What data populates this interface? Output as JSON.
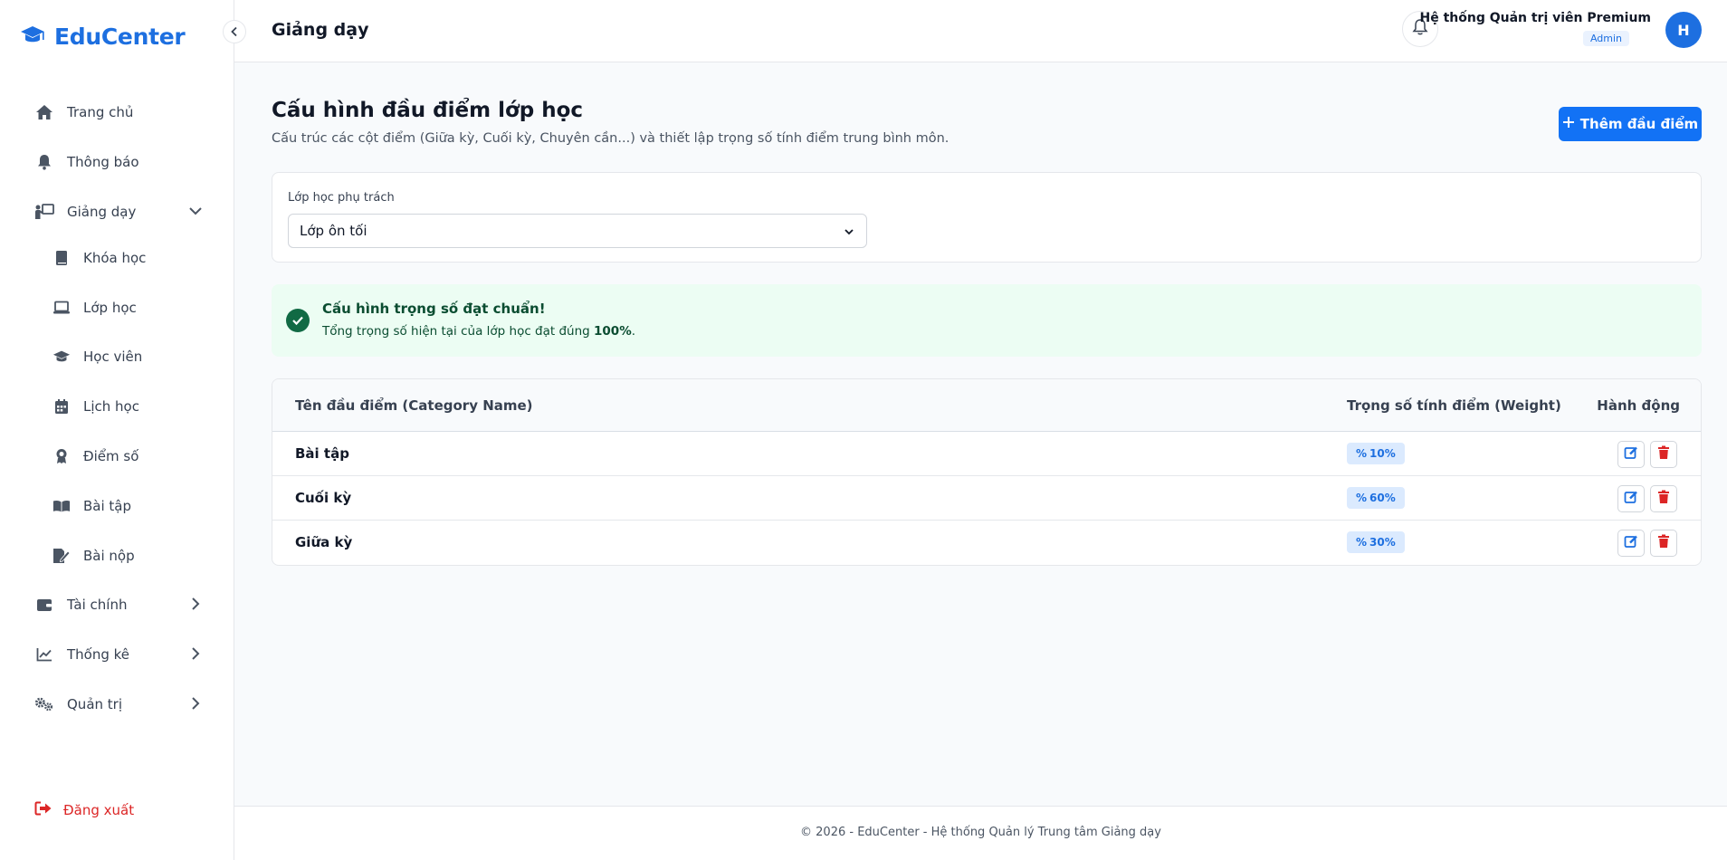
{
  "brand": {
    "name": "EduCenter"
  },
  "sidebar": {
    "items": [
      {
        "label": "Trang chủ",
        "icon": "home-icon"
      },
      {
        "label": "Thông báo",
        "icon": "bell-icon"
      },
      {
        "label": "Giảng dạy",
        "icon": "teacher-icon",
        "expanded": true
      },
      {
        "label": "Tài chính",
        "icon": "wallet-icon"
      },
      {
        "label": "Thống kê",
        "icon": "chart-line-icon"
      },
      {
        "label": "Quản trị",
        "icon": "gears-icon"
      }
    ],
    "sub_items": [
      {
        "label": "Khóa học",
        "icon": "book-icon"
      },
      {
        "label": "Lớp học",
        "icon": "laptop-icon"
      },
      {
        "label": "Học viên",
        "icon": "graduation-cap-icon"
      },
      {
        "label": "Lịch học",
        "icon": "calendar-icon"
      },
      {
        "label": "Điểm số",
        "icon": "award-icon"
      },
      {
        "label": "Bài tập",
        "icon": "open-book-icon"
      },
      {
        "label": "Bài nộp",
        "icon": "file-signature-icon"
      }
    ],
    "logout_label": "Đăng xuất"
  },
  "header": {
    "title": "Giảng dạy",
    "user_name": "Hệ thống Quản trị viên Premium",
    "user_role": "Admin",
    "avatar_initial": "H"
  },
  "main": {
    "title": "Cấu hình đầu điểm lớp học",
    "subtitle": "Cấu trúc các cột điểm (Giữa kỳ, Cuối kỳ, Chuyên cần...) và thiết lập trọng số tính điểm trung bình môn.",
    "add_button": "Thêm đầu điểm",
    "filter": {
      "label": "Lớp học phụ trách",
      "selected": "Lớp ôn tối"
    },
    "alert": {
      "title": "Cấu hình trọng số đạt chuẩn!",
      "text_before": "Tổng trọng số hiện tại của lớp học đạt đúng ",
      "highlight": "100%",
      "text_after": "."
    },
    "table": {
      "headers": [
        "Tên đầu điểm (Category Name)",
        "Trọng số tính điểm (Weight)",
        "Hành động"
      ],
      "rows": [
        {
          "name": "Bài tập",
          "weight": "10%"
        },
        {
          "name": "Cuối kỳ",
          "weight": "60%"
        },
        {
          "name": "Giữa kỳ",
          "weight": "30%"
        }
      ]
    }
  },
  "footer": {
    "text": "© 2026 - EduCenter - Hệ thống Quản lý Trung tâm Giảng dạy"
  },
  "colors": {
    "primary": "#1272f5",
    "success_bg": "#ecfdf3",
    "success_text": "#0b4d31",
    "danger": "#dc2626"
  }
}
